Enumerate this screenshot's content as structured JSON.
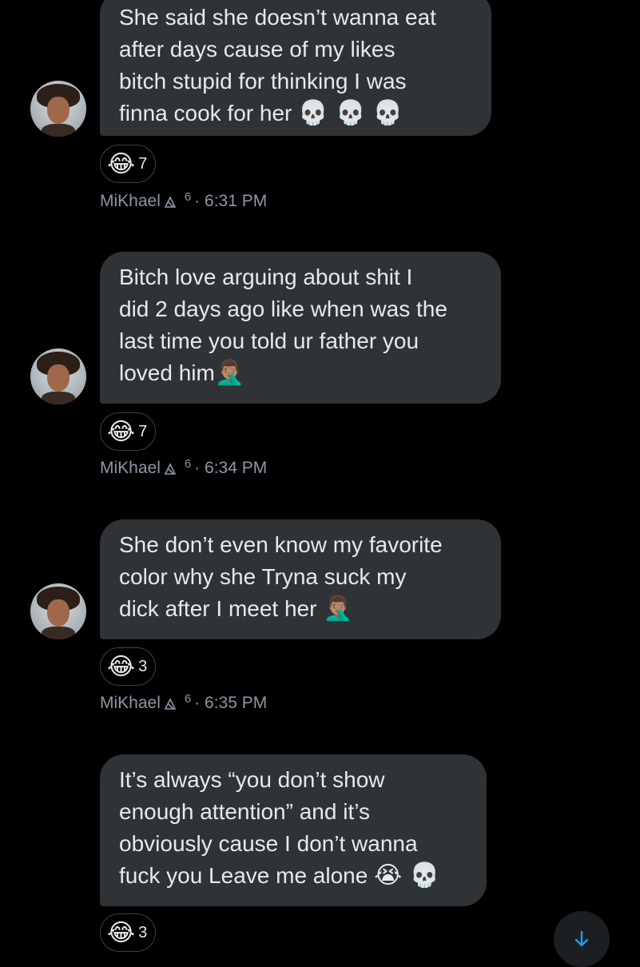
{
  "messages": [
    {
      "text": "She said she doesn’t wanna eat\nafter days cause of my likes\nbitch stupid for thinking I was\nfinna cook for her ",
      "emojis": "💀 💀 💀",
      "reaction": {
        "emoji": "😂",
        "count": "7"
      },
      "author": "MiKhael",
      "badge": "6",
      "time": "· 6:31 PM"
    },
    {
      "text": "Bitch love arguing about shit I\ndid 2 days ago like when was the\nlast time you told ur father you\nloved him",
      "emojis": "🤦🏽‍♂️",
      "reaction": {
        "emoji": "😂",
        "count": "7"
      },
      "author": "MiKhael",
      "badge": "6",
      "time": "· 6:34 PM"
    },
    {
      "text": "She don’t even know my favorite\ncolor why she Tryna suck my\ndick after I meet her ",
      "emojis": "🤦🏽‍♂️",
      "reaction": {
        "emoji": "😂",
        "count": "3"
      },
      "author": "MiKhael",
      "badge": "6",
      "time": "· 6:35 PM"
    },
    {
      "text": "It’s always “you don’t show\nenough attention” and it’s\nobviously cause I don’t wanna\nfuck you Leave me alone ",
      "emojis": "😭 💀",
      "reaction": {
        "emoji": "😂",
        "count": "3"
      }
    }
  ],
  "scroll_button": {
    "icon": "arrow-down-icon",
    "color": "#1d9bf0"
  }
}
